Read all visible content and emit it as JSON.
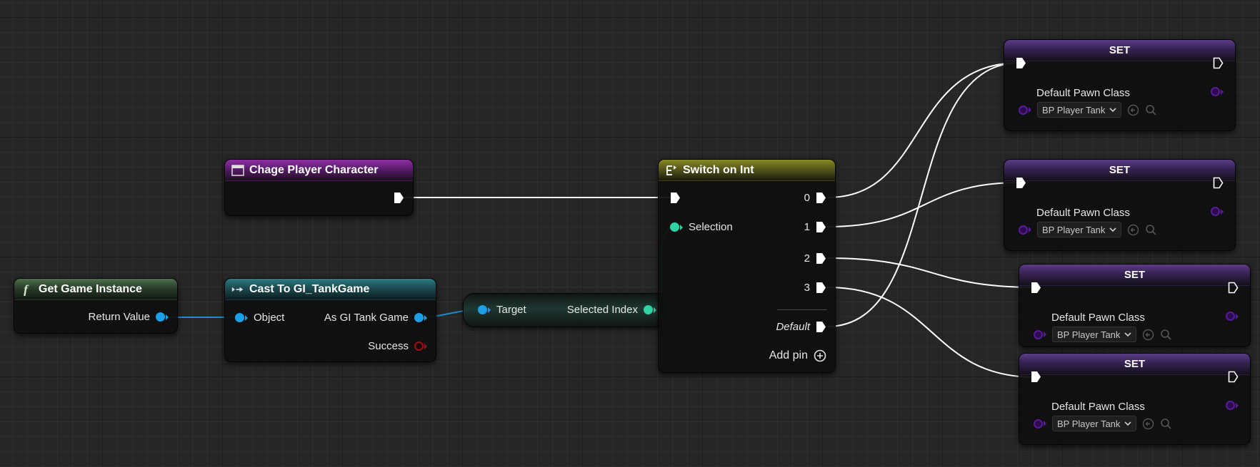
{
  "nodes": {
    "get_game_instance": {
      "title": "Get Game Instance",
      "output": "Return Value"
    },
    "event": {
      "title": "Chage Player Character"
    },
    "cast": {
      "title": "Cast To GI_TankGame",
      "input": "Object",
      "output": "As GI Tank Game",
      "success": "Success"
    },
    "getter": {
      "input": "Target",
      "output": "Selected Index"
    },
    "switch": {
      "title": "Switch on Int",
      "selection": "Selection",
      "outputs": [
        "0",
        "1",
        "2",
        "3"
      ],
      "default": "Default",
      "add_pin": "Add pin"
    },
    "set_nodes": [
      {
        "title": "SET",
        "var": "Default Pawn Class",
        "value": "BP Player Tank"
      },
      {
        "title": "SET",
        "var": "Default Pawn Class",
        "value": "BP Player Tank"
      },
      {
        "title": "SET",
        "var": "Default Pawn Class",
        "value": "BP Player Tank"
      },
      {
        "title": "SET",
        "var": "Default Pawn Class",
        "value": "BP Player Tank"
      }
    ]
  },
  "colors": {
    "exec_wire": "#ffffff",
    "object_pin": "#1aa0e6",
    "int_pin": "#2ed3a3",
    "bool_pin": "#a01010",
    "class_pin": "#5a1a9a",
    "grid_bg": "#262626"
  },
  "icons": {
    "function": "function-icon",
    "event": "event-icon",
    "cast": "cast-icon",
    "switch": "switch-icon",
    "browse": "browse-arrow-icon",
    "search": "search-icon",
    "add": "add-pin-icon"
  }
}
